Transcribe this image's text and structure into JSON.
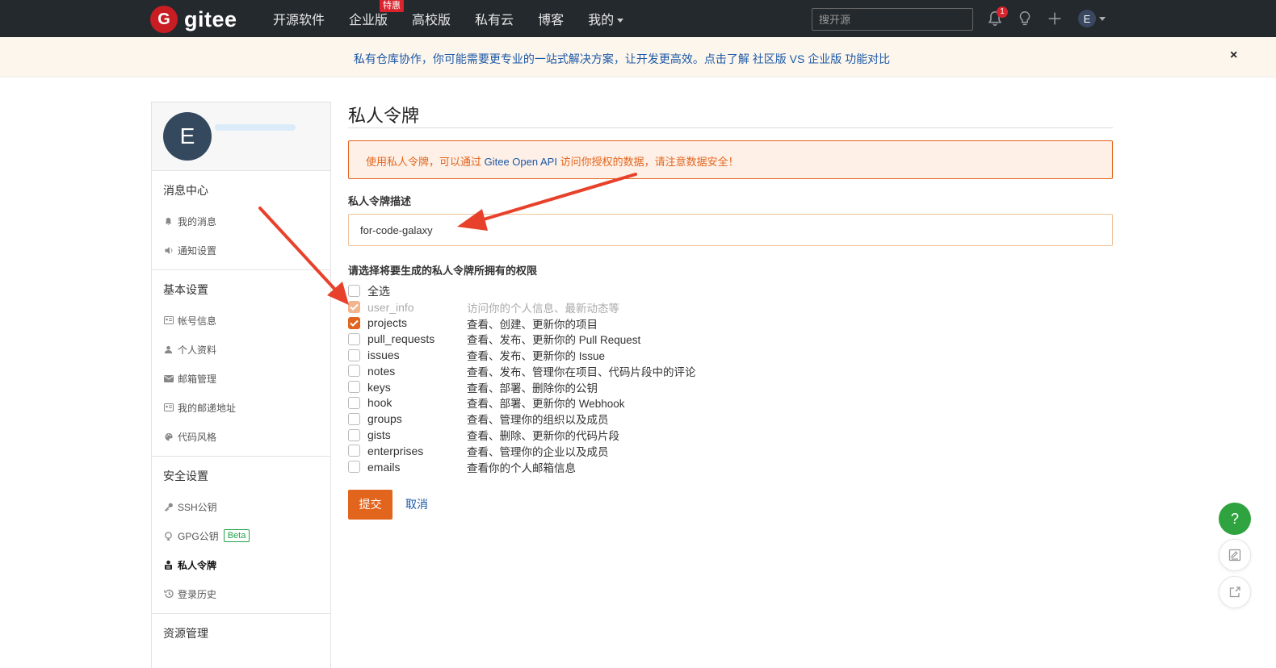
{
  "header": {
    "logo_mark": "G",
    "logo_text": "gitee",
    "nav": [
      {
        "label": "开源软件"
      },
      {
        "label": "企业版",
        "badge": "特惠"
      },
      {
        "label": "高校版"
      },
      {
        "label": "私有云"
      },
      {
        "label": "博客"
      },
      {
        "label": "我的"
      }
    ],
    "search_placeholder": "搜开源",
    "notification_count": "1",
    "user_initial": "E"
  },
  "notice": {
    "text": "私有仓库协作，你可能需要更专业的一站式解决方案，让开发更高效。点击了解 社区版 VS 企业版 功能对比",
    "close": "×"
  },
  "sidebar": {
    "avatar_initial": "E",
    "sections": [
      {
        "title": "消息中心",
        "items": [
          {
            "label": "我的消息",
            "icon": "bell-icon"
          },
          {
            "label": "通知设置",
            "icon": "speaker-icon"
          }
        ]
      },
      {
        "title": "基本设置",
        "items": [
          {
            "label": "帐号信息",
            "icon": "id-card-icon"
          },
          {
            "label": "个人资料",
            "icon": "user-icon"
          },
          {
            "label": "邮箱管理",
            "icon": "envelope-icon"
          },
          {
            "label": "我的邮递地址",
            "icon": "address-card-icon"
          },
          {
            "label": "代码风格",
            "icon": "palette-icon"
          }
        ]
      },
      {
        "title": "安全设置",
        "items": [
          {
            "label": "SSH公钥",
            "icon": "key-icon"
          },
          {
            "label": "GPG公钥",
            "icon": "gpg-key-icon",
            "badge": "Beta"
          },
          {
            "label": "私人令牌",
            "icon": "token-icon",
            "active": true
          },
          {
            "label": "登录历史",
            "icon": "history-icon"
          }
        ]
      },
      {
        "title": "资源管理",
        "items": []
      }
    ]
  },
  "main": {
    "title": "私人令牌",
    "alert_pre": "使用私人令牌，可以通过 ",
    "alert_api": "Gitee Open API",
    "alert_post": " 访问你授权的数据，请注意数据安全！",
    "desc_label": "私人令牌描述",
    "desc_value": "for-code-galaxy",
    "perm_label": "请选择将要生成的私人令牌所拥有的权限",
    "select_all": "全选",
    "permissions": [
      {
        "name": "user_info",
        "desc": "访问你的个人信息、最新动态等",
        "state": "disabled"
      },
      {
        "name": "projects",
        "desc": "查看、创建、更新你的项目",
        "state": "checked"
      },
      {
        "name": "pull_requests",
        "desc": "查看、发布、更新你的 Pull Request",
        "state": "unchecked"
      },
      {
        "name": "issues",
        "desc": "查看、发布、更新你的 Issue",
        "state": "unchecked"
      },
      {
        "name": "notes",
        "desc": "查看、发布、管理你在项目、代码片段中的评论",
        "state": "unchecked"
      },
      {
        "name": "keys",
        "desc": "查看、部署、删除你的公钥",
        "state": "unchecked"
      },
      {
        "name": "hook",
        "desc": "查看、部署、更新你的 Webhook",
        "state": "unchecked"
      },
      {
        "name": "groups",
        "desc": "查看、管理你的组织以及成员",
        "state": "unchecked"
      },
      {
        "name": "gists",
        "desc": "查看、删除、更新你的代码片段",
        "state": "unchecked"
      },
      {
        "name": "enterprises",
        "desc": "查看、管理你的企业以及成员",
        "state": "unchecked"
      },
      {
        "name": "emails",
        "desc": "查看你的个人邮箱信息",
        "state": "unchecked"
      }
    ],
    "submit": "提交",
    "cancel": "取消"
  },
  "floating": {
    "help": "?"
  },
  "colors": {
    "accent": "#e2651e",
    "link": "#1b58a7",
    "nav_bg": "#24292e",
    "annotation_arrow": "#e8412b"
  }
}
